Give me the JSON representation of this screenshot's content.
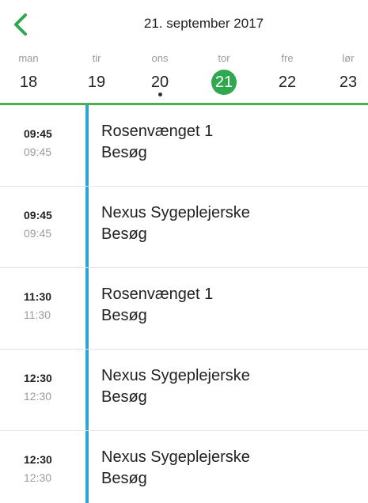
{
  "header": {
    "title": "21. september 2017",
    "back_icon": "chevron-left-icon"
  },
  "colors": {
    "accent_green": "#2fa84f",
    "divider_green": "#4caf50",
    "appointment_bar": "#2aa6d6"
  },
  "week": {
    "days": [
      {
        "name": "man",
        "num": "18",
        "selected": false,
        "has_event": false
      },
      {
        "name": "tir",
        "num": "19",
        "selected": false,
        "has_event": false
      },
      {
        "name": "ons",
        "num": "20",
        "selected": false,
        "has_event": true
      },
      {
        "name": "tor",
        "num": "21",
        "selected": true,
        "has_event": false
      },
      {
        "name": "fre",
        "num": "22",
        "selected": false,
        "has_event": false
      },
      {
        "name": "lør",
        "num": "23",
        "selected": false,
        "has_event": false
      }
    ]
  },
  "appointments": [
    {
      "start": "09:45",
      "end": "09:45",
      "title": "Rosenvænget 1",
      "subtitle": "Besøg"
    },
    {
      "start": "09:45",
      "end": "09:45",
      "title": "Nexus Sygeplejerske",
      "subtitle": "Besøg"
    },
    {
      "start": "11:30",
      "end": "11:30",
      "title": "Rosenvænget 1",
      "subtitle": "Besøg"
    },
    {
      "start": "12:30",
      "end": "12:30",
      "title": "Nexus Sygeplejerske",
      "subtitle": "Besøg"
    },
    {
      "start": "12:30",
      "end": "12:30",
      "title": "Nexus Sygeplejerske",
      "subtitle": "Besøg"
    }
  ]
}
